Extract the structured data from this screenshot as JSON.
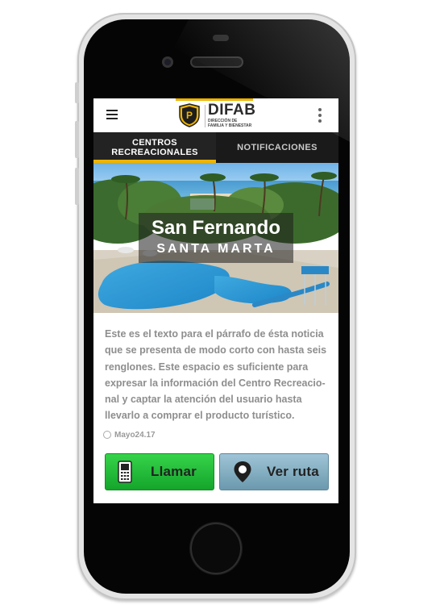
{
  "app": {
    "logo_title": "DIFAB",
    "logo_sub_line1": "DIRECCIÓN DE",
    "logo_sub_line2": "FAMILIA Y BIENESTAR",
    "logo_emblem_letter": "P"
  },
  "icons": {
    "menu": "hamburger-icon",
    "more": "kebab-icon",
    "phone": "phone-icon",
    "location": "map-pin-icon",
    "clock": "clock-icon"
  },
  "tabs": [
    {
      "label_line1": "CENTROS",
      "label_line2": "RECREACIONALES",
      "active": true
    },
    {
      "label": "NOTIFICACIONES",
      "active": false
    }
  ],
  "hero": {
    "title": "San Fernando",
    "subtitle": "SANTA MARTA"
  },
  "article": {
    "lines": [
      "Este es el texto para el párrafo de ésta noticia",
      "que se presenta de modo corto con hasta seis",
      "renglones. Este espacio es suficiente para",
      "expresar la información del Centro Recreacio-",
      "nal y captar la atención del usuario hasta",
      "llevarlo a comprar el producto turístico."
    ],
    "date": "Mayo24.17"
  },
  "actions": {
    "call_label": "Llamar",
    "route_label": "Ver ruta"
  },
  "colors": {
    "accent": "#f0b400",
    "tab_bar": "#1a1a1a",
    "call_button": "#1fb836",
    "route_button": "#86b0c4"
  }
}
